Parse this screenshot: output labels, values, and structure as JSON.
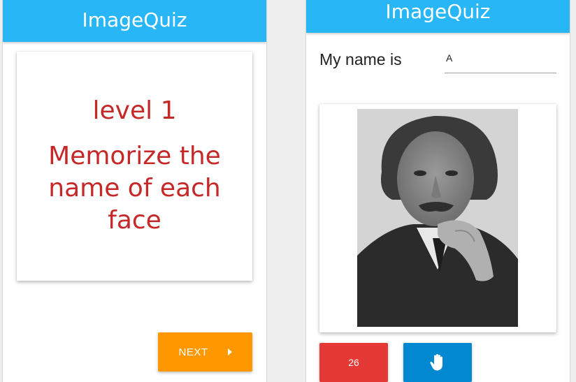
{
  "left_screen": {
    "app_title": "ImageQuiz",
    "level_title": "level 1",
    "instruction": "Memorize the name of each face",
    "next_label": "NEXT"
  },
  "right_screen": {
    "app_title": "ImageQuiz",
    "name_label": "My name is",
    "name_input_value": "A",
    "counter_value": "26",
    "hand_icon": "hand-icon"
  },
  "colors": {
    "app_bar": "#29b6f6",
    "accent_text": "#c62828",
    "next_button": "#ff9800",
    "counter_button": "#e53935",
    "hand_button": "#0288d1"
  }
}
